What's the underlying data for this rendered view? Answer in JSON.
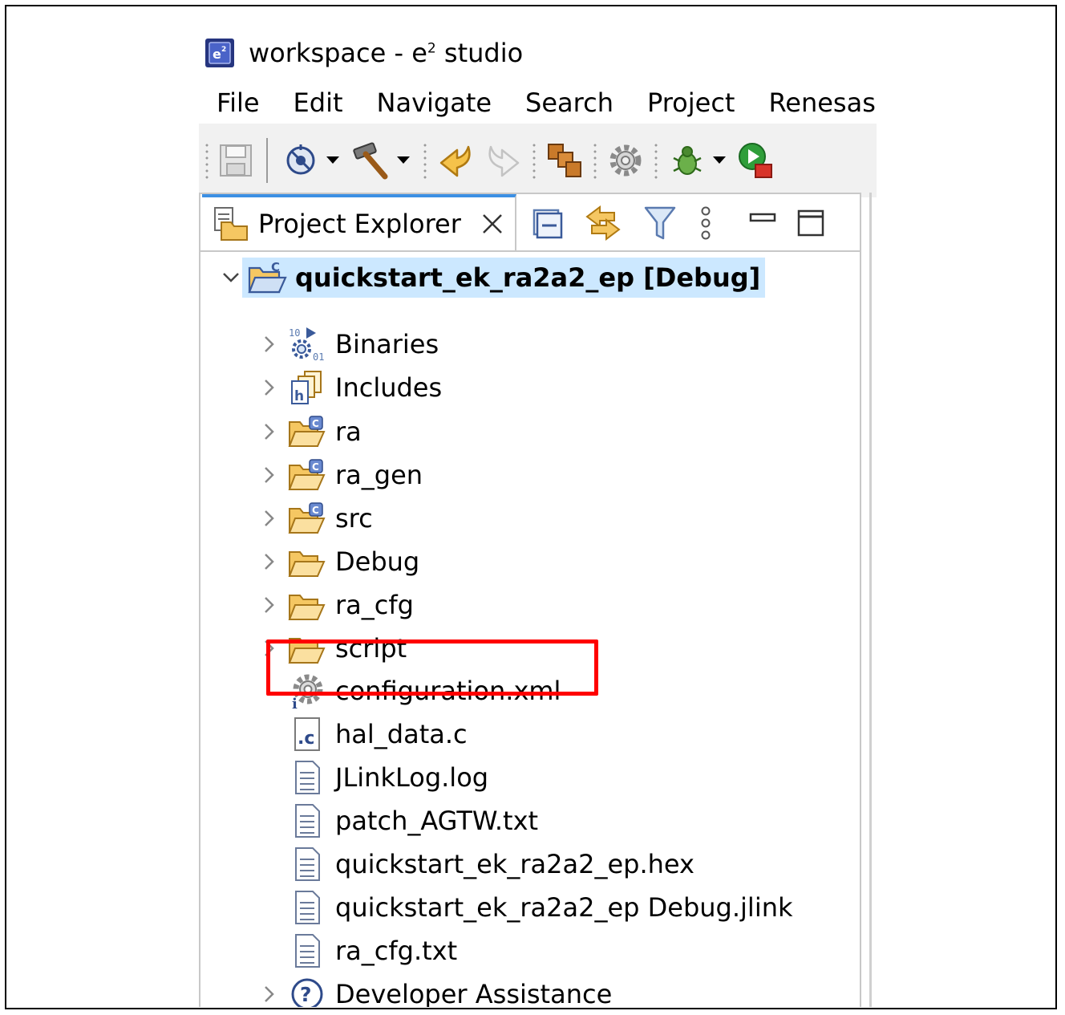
{
  "window": {
    "title_prefix": "workspace - e",
    "title_superscript": "2",
    "title_suffix": " studio"
  },
  "menu": [
    "File",
    "Edit",
    "Navigate",
    "Search",
    "Project",
    "Renesas V"
  ],
  "view_tab": {
    "label": "Project Explorer"
  },
  "tree": {
    "project": "quickstart_ek_ra2a2_ep [Debug]",
    "items": [
      {
        "label": "Binaries",
        "icon": "binaries-icon",
        "expandable": true
      },
      {
        "label": "Includes",
        "icon": "includes-icon",
        "expandable": true
      },
      {
        "label": "ra",
        "icon": "source-folder-icon",
        "expandable": true
      },
      {
        "label": "ra_gen",
        "icon": "source-folder-icon",
        "expandable": true
      },
      {
        "label": "src",
        "icon": "source-folder-icon",
        "expandable": true
      },
      {
        "label": "Debug",
        "icon": "folder-icon",
        "expandable": true
      },
      {
        "label": "ra_cfg",
        "icon": "folder-icon",
        "expandable": true
      },
      {
        "label": "script",
        "icon": "folder-icon",
        "expandable": true
      },
      {
        "label": "configuration.xml",
        "icon": "config-gear-icon",
        "expandable": false
      },
      {
        "label": "hal_data.c",
        "icon": "c-file-icon",
        "expandable": false
      },
      {
        "label": "JLinkLog.log",
        "icon": "text-file-icon",
        "expandable": false
      },
      {
        "label": "patch_AGTW.txt",
        "icon": "text-file-icon",
        "expandable": false
      },
      {
        "label": "quickstart_ek_ra2a2_ep.hex",
        "icon": "text-file-icon",
        "expandable": false
      },
      {
        "label": "quickstart_ek_ra2a2_ep Debug.jlink",
        "icon": "text-file-icon",
        "expandable": false
      },
      {
        "label": "ra_cfg.txt",
        "icon": "text-file-icon",
        "expandable": false
      },
      {
        "label": "Developer Assistance",
        "icon": "help-icon",
        "expandable": true
      }
    ]
  },
  "highlight": {
    "target": "configuration.xml",
    "color": "#ff0000"
  },
  "colors": {
    "selection": "#cce8ff",
    "active_tab": "#3c8fe3",
    "toolbar_bg": "#f1f1f1"
  }
}
